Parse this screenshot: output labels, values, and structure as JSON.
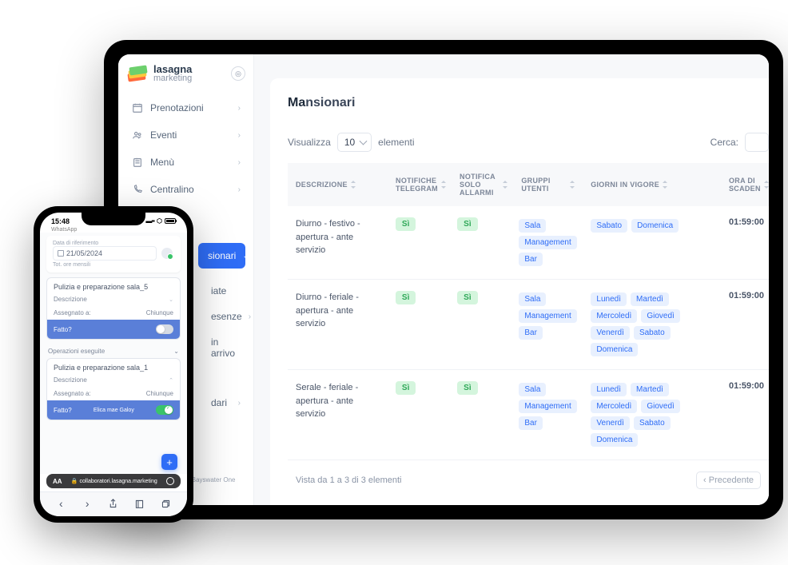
{
  "tablet": {
    "logo": {
      "line1": "lasagna",
      "line2": "marketing"
    },
    "nav": [
      {
        "label": "Prenotazioni",
        "icon": "calendar"
      },
      {
        "label": "Eventi",
        "icon": "people"
      },
      {
        "label": "Menù",
        "icon": "menu-board"
      },
      {
        "label": "Centralino",
        "icon": "phone"
      }
    ],
    "nav_active": "sionari",
    "nav_partial": [
      {
        "label": "iate"
      },
      {
        "label": "esenze"
      },
      {
        "label": "in arrivo"
      },
      {
        "label": "dari"
      }
    ],
    "copyright": "COPYRIGHT © 2024 Bayswater One Ltd",
    "page_title_hl": "Ma",
    "page_title_rest": "nsionari",
    "show_label_pre": "Visualizza",
    "show_value": "10",
    "show_label_post": "elementi",
    "search_label": "Cerca:",
    "columns": {
      "desc": "DESCRIZIONE",
      "tg": "NOTIFICHE TELEGRAM",
      "alarm": "NOTIFICA SOLO ALLARMI",
      "groups": "GRUPPI UTENTI",
      "days": "GIORNI IN VIGORE",
      "time": "ORA DI SCADEN"
    },
    "yes": "Sì",
    "groups": {
      "sala": "Sala",
      "mgmt": "Management",
      "bar": "Bar"
    },
    "days": {
      "lun": "Lunedì",
      "mar": "Martedì",
      "mer": "Mercoledì",
      "gio": "Giovedì",
      "ven": "Venerdì",
      "sab": "Sabato",
      "dom": "Domenica"
    },
    "rows": [
      {
        "desc": "Diurno - festivo - apertura - ante servizio",
        "days": [
          "sab",
          "dom"
        ],
        "time": "01:59:00"
      },
      {
        "desc": "Diurno - feriale - apertura - ante servizio",
        "days": [
          "lun",
          "mar",
          "mer",
          "gio",
          "ven",
          "sab",
          "dom"
        ],
        "time": "01:59:00"
      },
      {
        "desc": "Serale - feriale - apertura - ante servizio",
        "days": [
          "lun",
          "mar",
          "mer",
          "gio",
          "ven",
          "sab",
          "dom"
        ],
        "time": "01:59:00"
      }
    ],
    "footer_info": "Vista da 1 a 3 di 3 elementi",
    "pager_prev": "‹ Precedente"
  },
  "phone": {
    "time": "15:48",
    "sub": "WhatsApp",
    "ref_label": "Data di riferimento",
    "ref_date": "21/05/2024",
    "ref_sub": "Tot. ore mensili",
    "task1": {
      "title": "Pulizia e preparazione sala_5",
      "desc_label": "Descrizione",
      "assigned_label": "Assegnato a:",
      "assigned_value": "Chiunque",
      "done_label": "Fatto?"
    },
    "ops_header": "Operazioni eseguite",
    "task2": {
      "title": "Pulizia e preparazione sala_1",
      "desc_label": "Descrizione",
      "assigned_label": "Assegnato a:",
      "assigned_value": "Chiunque",
      "done_label": "Fatto?",
      "done_by": "Elica mae Galoy"
    },
    "url": "collaboratori.lasagna.marketing",
    "url_aa": "AA",
    "url_lock": "🔒"
  }
}
